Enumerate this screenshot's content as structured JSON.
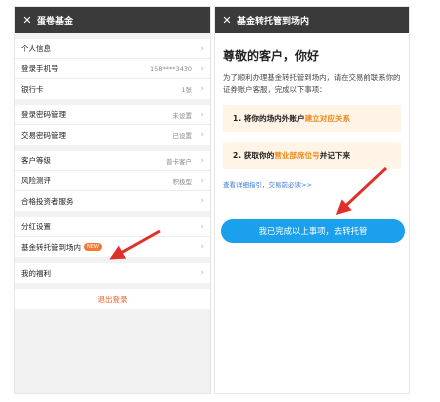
{
  "left": {
    "title": "蛋卷基金",
    "close_glyph": "✕",
    "groups": [
      [
        {
          "label": "个人信息",
          "value": ""
        },
        {
          "label": "登录手机号",
          "value": "158****3430"
        },
        {
          "label": "银行卡",
          "value": "1张"
        }
      ],
      [
        {
          "label": "登录密码管理",
          "value": "未设置"
        },
        {
          "label": "交易密码管理",
          "value": "已设置"
        }
      ],
      [
        {
          "label": "客户等级",
          "value": "普卡客户"
        },
        {
          "label": "风险测评",
          "value": "积极型"
        },
        {
          "label": "合格投资者服务",
          "value": ""
        }
      ],
      [
        {
          "label": "分红设置",
          "value": ""
        },
        {
          "label": "基金转托管到场内",
          "value": "",
          "badge": "NEW"
        }
      ],
      [
        {
          "label": "我的福利",
          "value": ""
        }
      ]
    ],
    "logout": "退出登录",
    "chevron_icon": "chevron-right-icon"
  },
  "right": {
    "title": "基金转托管到场内",
    "close_glyph": "✕",
    "greeting": "尊敬的客户，你好",
    "intro": "为了顺利办理基金转托管到场内，请在交易前联系你的证券账户客服，完成以下事项：",
    "step1": {
      "prefix": "1. 将你的场内外账户",
      "highlight": "建立对应关系",
      "suffix": ""
    },
    "step2": {
      "prefix": "2. 获取你的",
      "highlight": "营业部席位号",
      "suffix": "并记下来"
    },
    "guide_link": "查看详细指引，交易前必读>>",
    "cta": "我已完成以上事项，去转托管"
  },
  "colors": {
    "accent_blue": "#1aa0ec",
    "accent_orange": "#f08a1e",
    "arrow_red": "#e0302a"
  }
}
